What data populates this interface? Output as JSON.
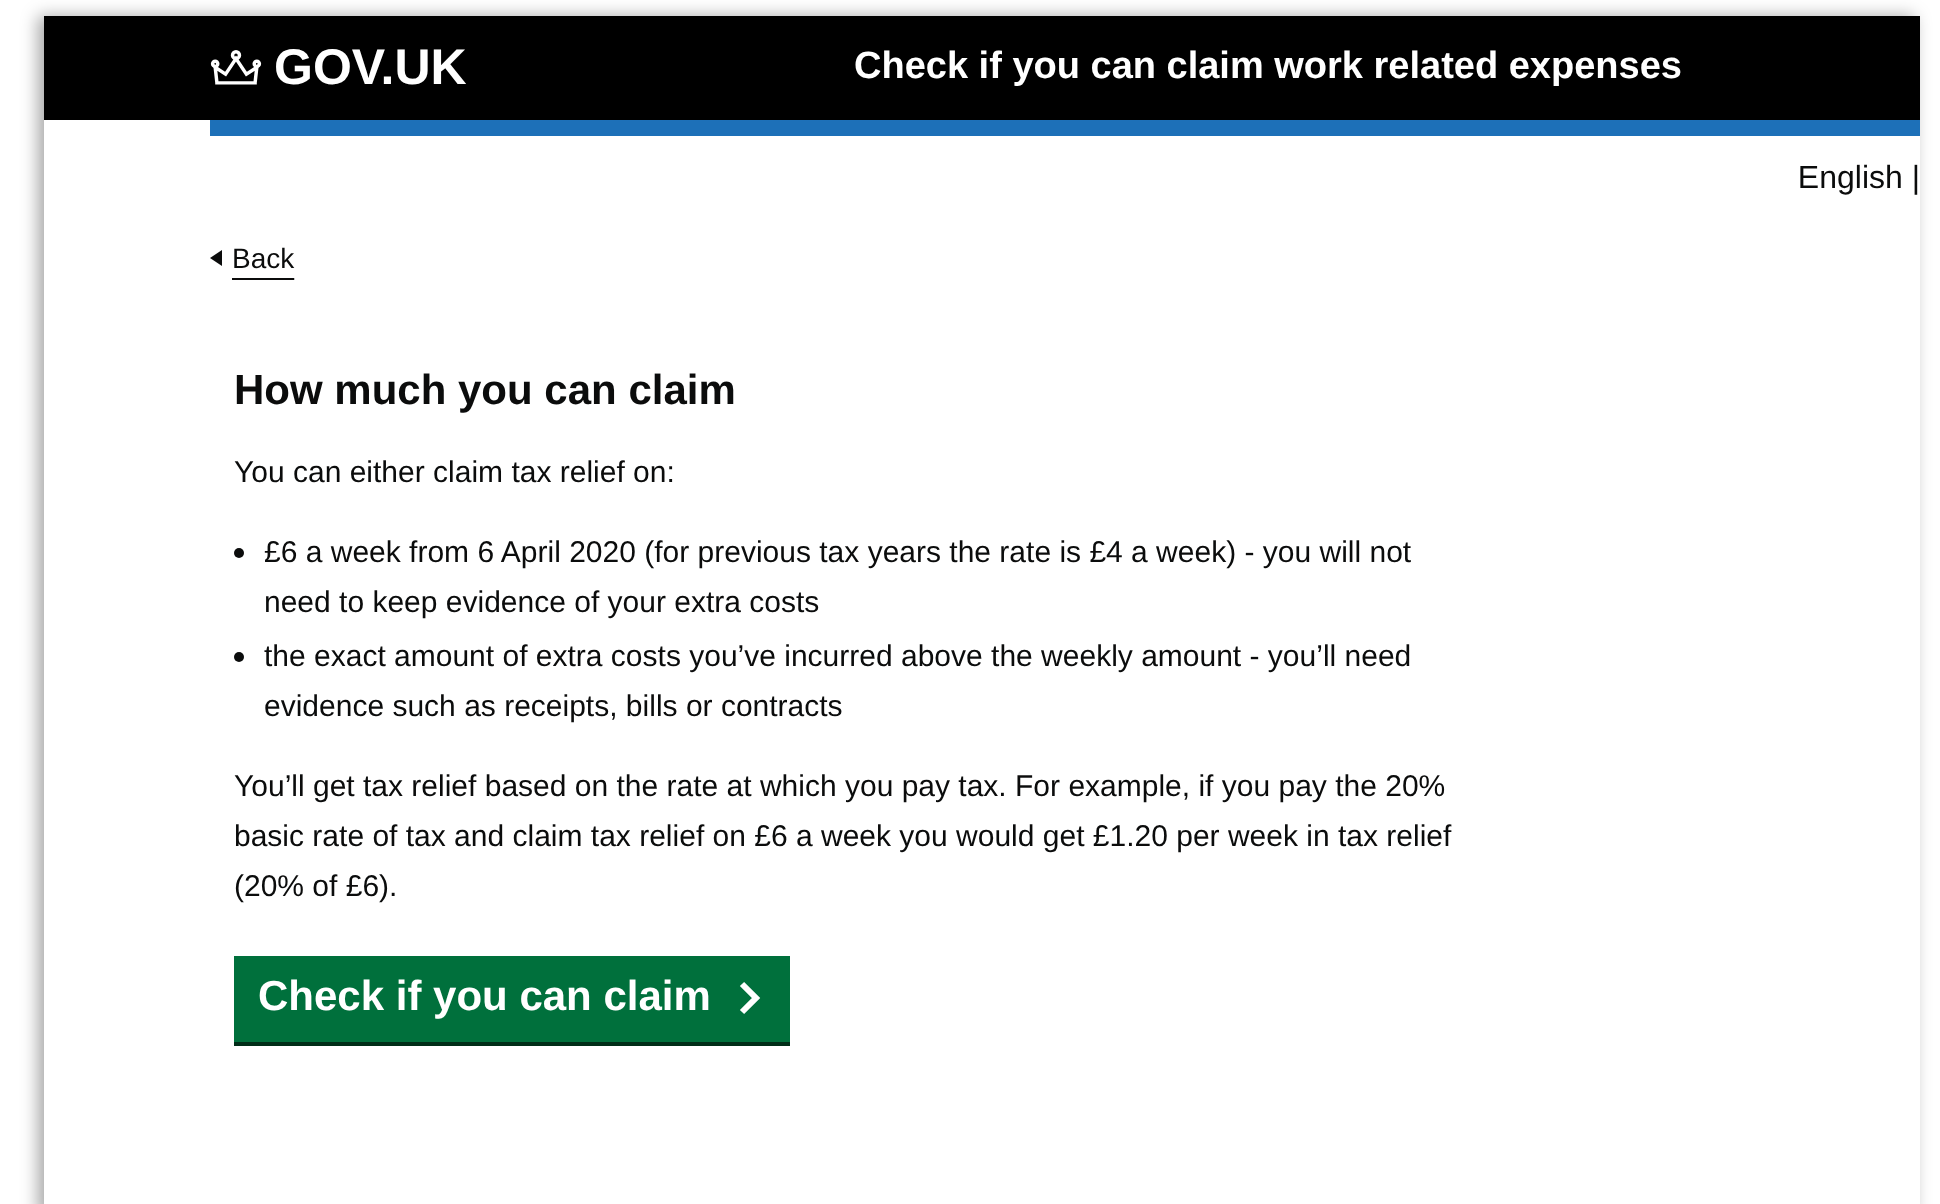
{
  "header": {
    "logo": "GOV.UK",
    "service_name": "Check if you can claim work related expenses"
  },
  "language_toggle": "English |",
  "back_link": "Back",
  "heading": "How much you can claim",
  "intro": "You can either claim tax relief on:",
  "bullets": [
    "£6 a week from 6 April 2020 (for previous tax years the rate is £4 a week) - you will not need to keep evidence of your extra costs",
    "the exact amount of extra costs you’ve incurred above the weekly amount - you’ll need evidence such as receipts, bills or contracts"
  ],
  "explanation": "You’ll get tax relief based on the rate at which you pay tax. For example, if you pay the 20% basic rate of tax and claim tax relief on £6 a week you would get £1.20 per week in tax relief (20% of £6).",
  "start_button": "Check if you can claim"
}
